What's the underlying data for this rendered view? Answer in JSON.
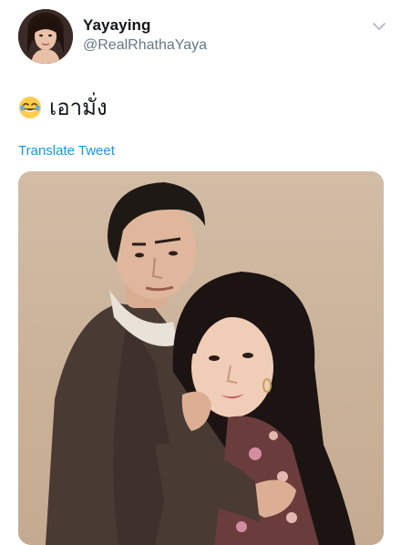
{
  "user": {
    "display_name": "Yayaying",
    "handle": "@RealRhathaYaya"
  },
  "tweet": {
    "emoji": "laughing-with-tears-emoji",
    "text": "เอามั่ง"
  },
  "translate_label": "Translate Tweet",
  "colors": {
    "link": "#1b95e0",
    "secondary_text": "#657786",
    "primary_text": "#14171a",
    "photo_backdrop": "#c9b29a"
  }
}
